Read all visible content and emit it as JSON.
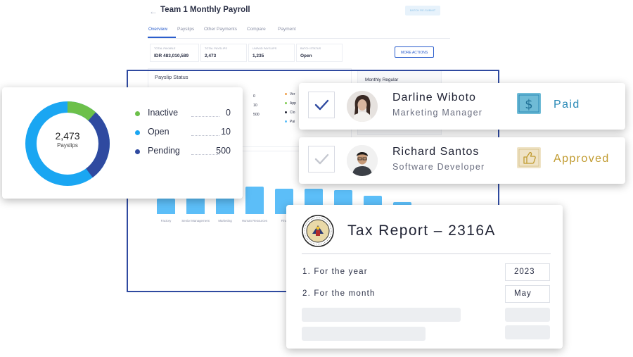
{
  "app": {
    "title": "Team 1 Monthly Payroll",
    "batch_button": "BATCH RE-SUBMIT",
    "tabs": [
      {
        "label": "Overview",
        "active": true
      },
      {
        "label": "Payslips",
        "active": false
      },
      {
        "label": "Other Payments",
        "active": false
      },
      {
        "label": "Compare",
        "active": false
      },
      {
        "label": "Payment",
        "active": false
      }
    ],
    "stats": [
      {
        "label": "TOTAL PAYABLE",
        "value": "IDR 483,010,589"
      },
      {
        "label": "TOTAL PAYSLIPS",
        "value": "2,473"
      },
      {
        "label": "UNPAID PAYSLIPS",
        "value": "1,235"
      },
      {
        "label": "BATCH STATUS",
        "value": "Open"
      }
    ],
    "more_actions": "MORE ACTIONS",
    "payslip_status_title": "Payslip Status",
    "mini_numbers": [
      "0",
      "10",
      "500"
    ],
    "mini_legend": [
      {
        "label": "Ver",
        "color": "#f0a04b"
      },
      {
        "label": "App",
        "color": "#7ecb4f"
      },
      {
        "label": "Clo",
        "color": "#1f2233"
      },
      {
        "label": "Pai",
        "color": "#5cbef8"
      }
    ],
    "monthly_regular_title": "Monthly Regular",
    "department_labels": [
      "Factory",
      "Senior Management",
      "Marketing",
      "Human Resources",
      "Fina"
    ]
  },
  "donut": {
    "value": "2,473",
    "label": "Payslips",
    "legend": [
      {
        "label": "Inactive",
        "value": "0",
        "color": "#6cc04a"
      },
      {
        "label": "Open",
        "value": "10",
        "color": "#1aa6f2"
      },
      {
        "label": "Pending",
        "value": "500",
        "color": "#2f4aa0"
      }
    ]
  },
  "employees": [
    {
      "name": "Darline Wiboto",
      "role": "Marketing Manager",
      "status": "Paid",
      "checked": true,
      "status_color": "#2a8ab7"
    },
    {
      "name": "Richard Santos",
      "role": "Software Developer",
      "status": "Approved",
      "checked": false,
      "status_color": "#c09a2e"
    }
  ],
  "tax_report": {
    "title": "Tax Report – 2316A",
    "rows": [
      {
        "label": "1. For the year",
        "value": "2023"
      },
      {
        "label": "2. For the month",
        "value": "May"
      }
    ]
  }
}
